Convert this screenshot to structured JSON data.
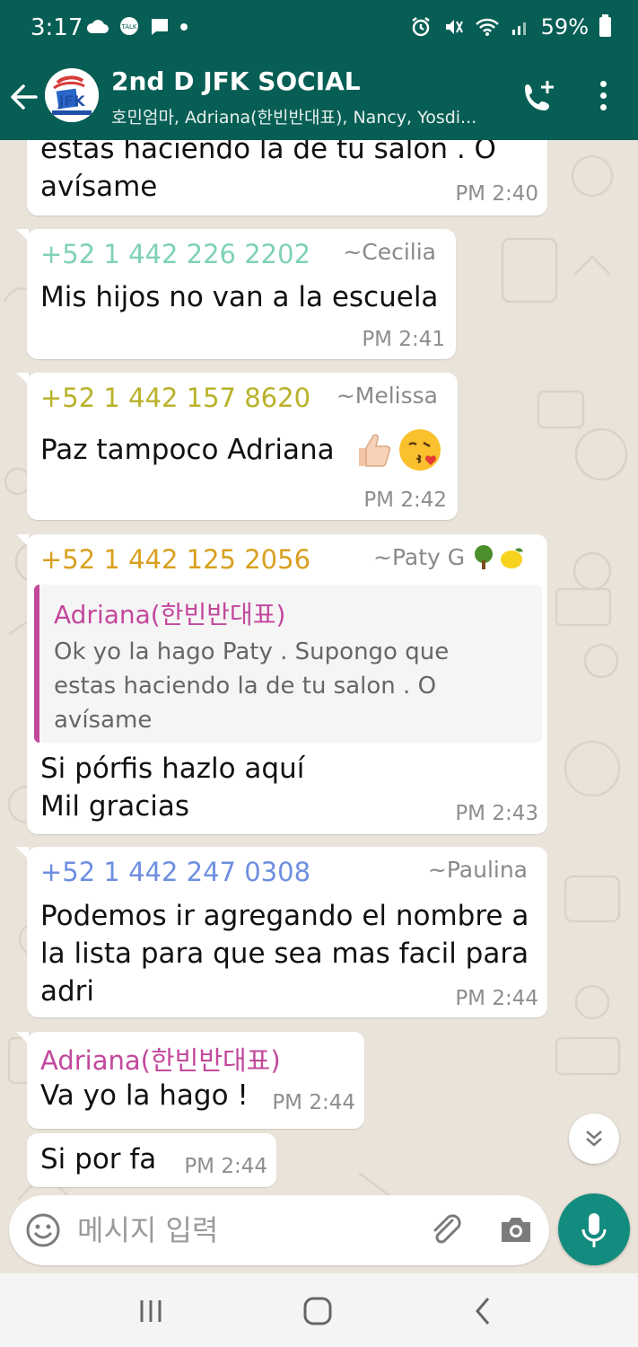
{
  "status_bar": {
    "time": "3:17",
    "left_icons": [
      "cloud-icon",
      "talk-icon",
      "chat-icon",
      "dot-icon"
    ],
    "battery": "59%",
    "right_icons": [
      "alarm-icon",
      "mute-icon",
      "wifi-icon",
      "signal-icon",
      "battery-icon"
    ]
  },
  "header": {
    "back_icon": "arrow-left-icon",
    "title": "2nd D JFK SOCIAL",
    "members": "호민엄마, Adriana(한빈반대표), Nancy, Yosdi...",
    "call_icon": "add-call-icon",
    "menu_icon": "more-vert-icon"
  },
  "colors": {
    "header": "#075e54",
    "accent": "#128c7e",
    "cecilia": "#7fd1b9",
    "melissa": "#b9b22a",
    "paty": "#d9a01f",
    "paulina": "#6e8fe0",
    "adriana": "#c2489c"
  },
  "messages": [
    {
      "text_line1": "estas haciendo la de tu salon . O",
      "text_line2": "avísame",
      "time": "PM 2:40"
    },
    {
      "phone": "+52 1 442 226 2202",
      "name": "~Cecilia",
      "text": "Mis hijos no van a la escuela",
      "time": "PM 2:41"
    },
    {
      "phone": "+52 1 442 157 8620",
      "name": "~Melissa",
      "text": "Paz tampoco Adriana",
      "emojis": [
        "thumbs-up-icon",
        "kissing-face-icon"
      ],
      "time": "PM 2:42"
    },
    {
      "phone": "+52 1 442 125 2056",
      "name": "~Paty G",
      "name_emojis": [
        "tree-icon",
        "lemon-icon"
      ],
      "quote_author": "Adriana(한빈반대표)",
      "quote_line1": "Ok yo la hago Paty . Supongo que",
      "quote_line2": "estas haciendo la de tu salon . O",
      "quote_line3": "avísame",
      "text_line1": "Si pórfis hazlo aquí",
      "text_line2": "Mil gracias",
      "time": "PM 2:43"
    },
    {
      "phone": "+52 1 442 247 0308",
      "name": "~Paulina",
      "text_line1": "Podemos ir agregando el nombre a",
      "text_line2": "la lista para que sea mas facil para",
      "text_line3": "adri",
      "time": "PM 2:44"
    },
    {
      "name": "Adriana(한빈반대표)",
      "text": "Va yo la hago !",
      "time": "PM 2:44"
    },
    {
      "text": "Si por fa",
      "time": "PM 2:44"
    }
  ],
  "scroll_down_icon": "double-chevron-down-icon",
  "composer": {
    "placeholder": "메시지 입력",
    "emoji_icon": "smiley-icon",
    "attach_icon": "paperclip-icon",
    "camera_icon": "camera-icon",
    "mic_icon": "mic-icon"
  },
  "nav": {
    "recents_icon": "recents-icon",
    "home_icon": "home-icon",
    "back_icon": "nav-back-icon"
  }
}
